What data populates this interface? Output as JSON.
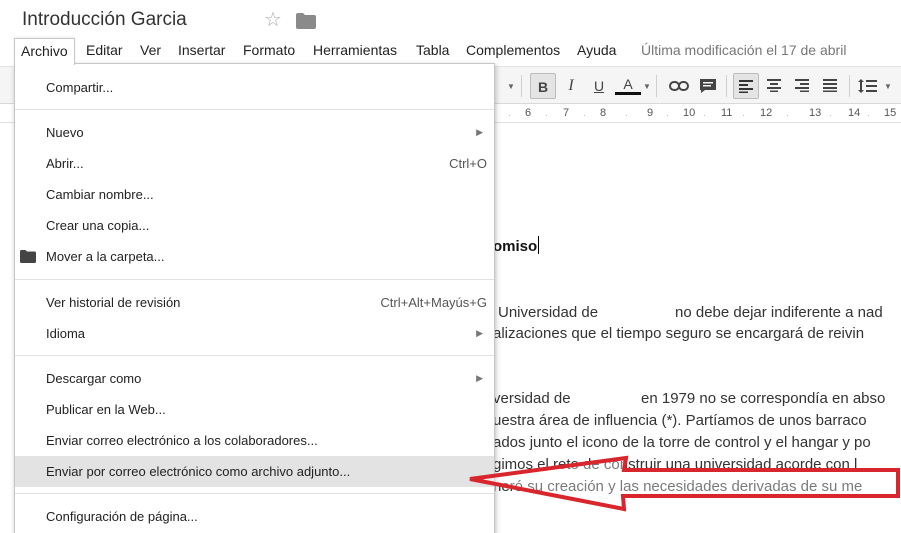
{
  "title_bar": {
    "doc_title": "Introducción Garcia"
  },
  "menu_bar": {
    "items": [
      "Archivo",
      "Editar",
      "Ver",
      "Insertar",
      "Formato",
      "Herramientas",
      "Tabla",
      "Complementos",
      "Ayuda"
    ],
    "last_modified": "Última modificación el 17 de abril"
  },
  "toolbar": {
    "bold": "B",
    "italic": "I",
    "underline": "U",
    "text_color": "A"
  },
  "ruler": {
    "numbers": [
      "6",
      "7",
      "8",
      "9",
      "10",
      "11",
      "12",
      "13",
      "14",
      "15"
    ]
  },
  "document": {
    "heading_fragment": "omiso",
    "lines": [
      "Universidad de",
      "no debe dejar indiferente a nad",
      "alizaciones que el tiempo seguro se encargará de reivin",
      "versidad de",
      "en 1979 no se correspondía en abso",
      "uestra área de influencia (*). Partíamos de unos barraco",
      "ados junto el icono de la torre de control y el hangar y po",
      "gimos el reto de construir una universidad acorde con l",
      "neró su creación y las necesidades derivadas de su me"
    ]
  },
  "file_menu": {
    "share": "Compartir...",
    "new": "Nuevo",
    "open": "Abrir...",
    "open_shortcut": "Ctrl+O",
    "rename": "Cambiar nombre...",
    "make_copy": "Crear una copia...",
    "move_to_folder": "Mover a la carpeta...",
    "revision_history": "Ver historial de revisión",
    "revision_history_shortcut": "Ctrl+Alt+Mayús+G",
    "language": "Idioma",
    "download_as": "Descargar como",
    "publish_web": "Publicar en la Web...",
    "email_collaborators": "Enviar correo electrónico a los colaboradores...",
    "email_attachment": "Enviar por correo electrónico como archivo adjunto...",
    "page_setup": "Configuración de página..."
  },
  "colors": {
    "accent_red": "#d9262c",
    "menu_highlight": "#e3e3e3"
  }
}
